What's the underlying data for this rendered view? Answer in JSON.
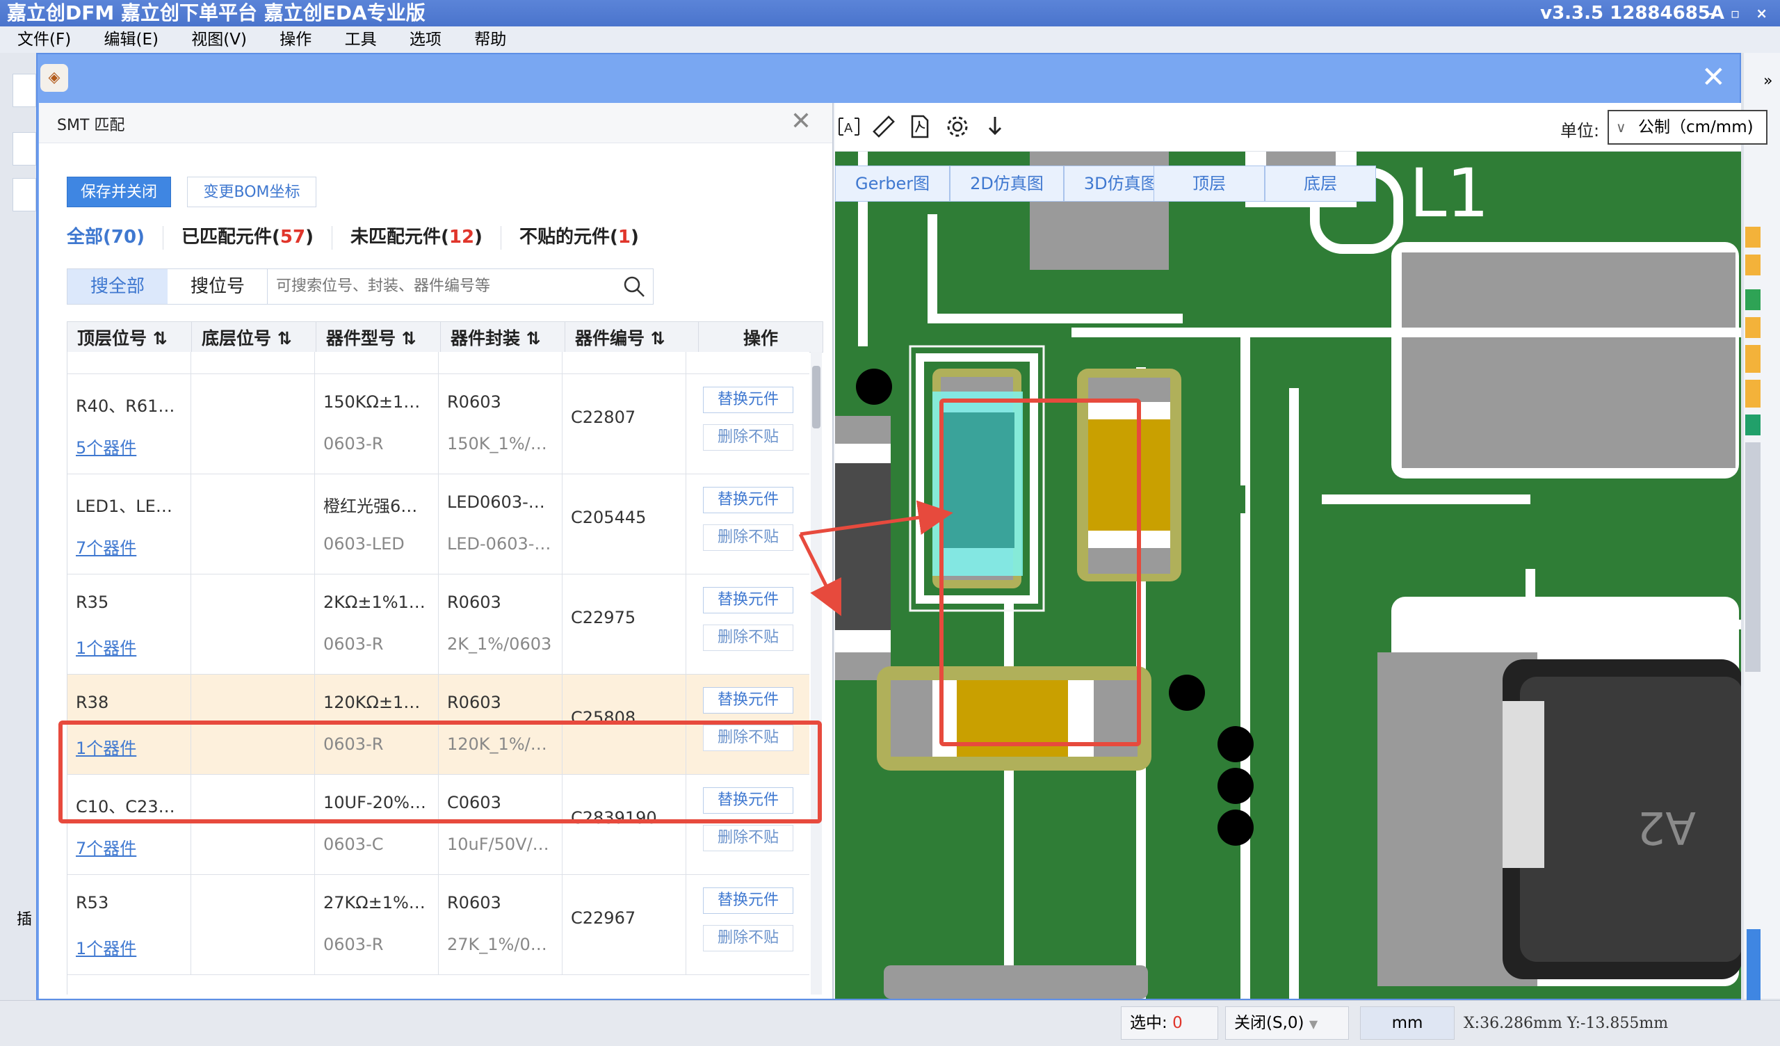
{
  "app": {
    "title": "嘉立创DFM  嘉立创下单平台  嘉立创EDA专业版",
    "version": "v3.3.5  12884685A",
    "window_controls": "– ▫ ×"
  },
  "menu": [
    "文件(F)",
    "编辑(E)",
    "视图(V)",
    "操作",
    "工具",
    "选项",
    "帮助"
  ],
  "dialog": {
    "close": "✕"
  },
  "smt": {
    "title": "SMT 匹配",
    "close": "✕",
    "save_close": "保存并关闭",
    "change_bom": "变更BOM坐标",
    "filters": {
      "all_label": "全部",
      "all_count": "(70)",
      "matched_label": "已匹配元件",
      "matched_count": "57",
      "unmatched_label": "未匹配元件",
      "unmatched_count": "12",
      "nopaste_label": "不贴的元件",
      "nopaste_count": "1",
      "paren_open": "(",
      "paren_close": ")"
    },
    "search_tabs": [
      "搜全部",
      "搜位号"
    ],
    "search_placeholder": "可搜索位号、封装、器件编号等",
    "columns": [
      "顶层位号 ⇅",
      "底层位号 ⇅",
      "器件型号 ⇅",
      "器件封装 ⇅",
      "器件编号 ⇅",
      "操作"
    ],
    "rows": [
      {
        "top": "R40、R61…",
        "count": "5个器件",
        "model": "150KΩ±1…",
        "model_pkg": "0603-R",
        "pkg": "R0603",
        "pkg_sub": "150K_1%/…",
        "code": "C22807"
      },
      {
        "top": "LED1、LE…",
        "count": "7个器件",
        "model": "橙红光强6…",
        "model_pkg": "0603-LED",
        "pkg": "LED0603-…",
        "pkg_sub": "LED-0603-…",
        "code": "C205445"
      },
      {
        "top": "R35",
        "count": "1个器件",
        "model": "2KΩ±1%1…",
        "model_pkg": "0603-R",
        "pkg": "R0603",
        "pkg_sub": "2K_1%/0603",
        "code": "C22975"
      },
      {
        "top": "R38",
        "count": "1个器件",
        "model": "120KΩ±1…",
        "model_pkg": "0603-R",
        "pkg": "R0603",
        "pkg_sub": "120K_1%/…",
        "code": "C25808"
      },
      {
        "top": "C10、C23…",
        "count": "7个器件",
        "model": "10UF-20%…",
        "model_pkg": "0603-C",
        "pkg": "C0603",
        "pkg_sub": "10uF/50V/…",
        "code": "C2839190"
      },
      {
        "top": "R53",
        "count": "1个器件",
        "model": "27KΩ±1%…",
        "model_pkg": "0603-R",
        "pkg": "R0603",
        "pkg_sub": "27K_1%/0…",
        "code": "C22967"
      }
    ],
    "replace_label": "替换元件",
    "delete_label": "删除不贴"
  },
  "viewer": {
    "unit_label": "单位:",
    "unit_value": "公制（cm/mm)",
    "view_tabs": [
      "Gerber图",
      "2D仿真图",
      "3D仿真图"
    ],
    "layer_tabs": [
      "顶层",
      "底层"
    ],
    "silk_text": "L1",
    "silk_text2": "A2"
  },
  "left_gutter": {
    "label": "插"
  },
  "status": {
    "selected_label": "选中:",
    "selected_value": "0",
    "snap": "关闭(S,0)",
    "unit": "mm",
    "coords": "X:36.286mm Y:-13.855mm"
  },
  "colors": {
    "accent": "#3f86e2",
    "pcb_green": "#2f7d36",
    "highlight_red": "#e74a3d",
    "selected_row": "#fdf0dc"
  }
}
